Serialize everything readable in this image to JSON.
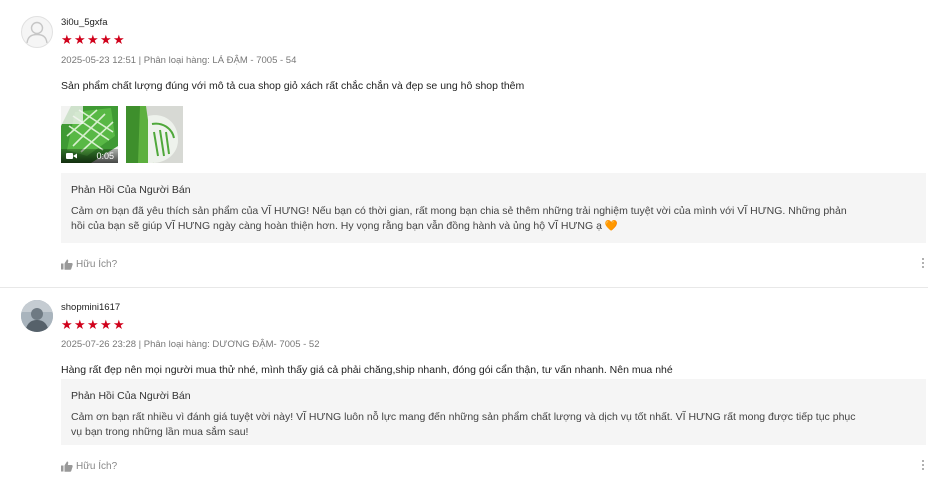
{
  "reviews": [
    {
      "username": "3i0u_5gxfa",
      "rating": 5,
      "meta": "2025-05-23 12:51 | Phân loại hàng: LÁ ĐẬM - 7005 - 54",
      "text": "Sản phẩm chất lượng đúng với mô tả cua shop giỏ xách rất chắc chắn và đẹp se ung hô shop thêm",
      "media": [
        {
          "type": "video",
          "duration": "0:05"
        },
        {
          "type": "image"
        }
      ],
      "seller_reply": {
        "title": "Phản Hồi Của Người Bán",
        "body": "Cảm ơn bạn đã yêu thích sản phẩm của VĨ HƯNG! Nếu bạn có thời gian, rất mong bạn chia sẻ thêm những trải nghiệm tuyệt vời của mình với VĨ HƯNG. Những phản\nhồi của bạn sẽ giúp VĨ HƯNG ngày càng hoàn thiện hơn. Hy vọng rằng bạn vẫn đồng hành và ủng hộ VĨ HƯNG ạ 🧡"
      },
      "helpful_label": "Hữu Ích?"
    },
    {
      "username": "shopmini1617",
      "rating": 5,
      "meta": "2025-07-26 23:28 | Phân loại hàng: DƯƠNG ĐẬM- 7005 - 52",
      "text": "Hàng rất đẹp nên mọi người mua thử nhé, mình thấy giá cả phải chăng,ship nhanh, đóng gói cẩn thận, tư vấn nhanh. Nên mua nhé",
      "seller_reply": {
        "title": "Phản Hồi Của Người Bán",
        "body": "Cảm ơn bạn rất nhiều vì đánh giá tuyệt vời này! VĨ HƯNG luôn nỗ lực mang đến những sản phẩm chất lượng và dịch vụ tốt nhất. VĨ HƯNG rất mong được tiếp tục phục\nvụ bạn trong những lần mua sắm sau!"
      },
      "helpful_label": "Hữu Ích?"
    }
  ],
  "colors": {
    "star": "#d0011b",
    "reply_bg": "#f5f5f5",
    "meta_text": "#777777"
  },
  "icons": {
    "avatar_placeholder": "user-silhouette-icon",
    "video": "video-camera-icon",
    "helpful": "thumbs-up-icon",
    "more": "vertical-ellipsis-icon"
  }
}
